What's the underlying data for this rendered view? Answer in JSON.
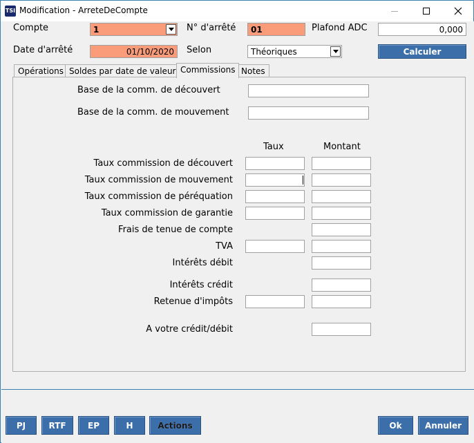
{
  "window": {
    "title": "Modification - ArreteDeCompte",
    "app_icon_text": "TSI"
  },
  "header": {
    "compte_label": "Compte",
    "compte_value": "1",
    "num_arrete_label": "N° d'arrêté",
    "num_arrete_value": "01",
    "plafond_label": "Plafond ADC",
    "plafond_value": "0,000",
    "date_arrete_label": "Date d'arrêté",
    "date_arrete_value": "01/10/2020",
    "selon_label": "Selon",
    "selon_value": "Théoriques",
    "calculer_label": "Calculer"
  },
  "tabs": [
    {
      "label": "Opérations",
      "active": false
    },
    {
      "label": "Soldes par date de valeur",
      "active": false
    },
    {
      "label": "Commissions",
      "active": true
    },
    {
      "label": "Notes",
      "active": false
    }
  ],
  "commissions": {
    "base_decouvert_label": "Base de la comm. de découvert",
    "base_decouvert_value": "",
    "base_mouvement_label": "Base de la comm. de mouvement",
    "base_mouvement_value": "",
    "col_taux": "Taux",
    "col_montant": "Montant",
    "rows": [
      {
        "label": "Taux commission de découvert",
        "taux": "",
        "montant": ""
      },
      {
        "label": "Taux commission de mouvement",
        "taux": "",
        "montant": ""
      },
      {
        "label": "Taux commission de péréquation",
        "taux": "",
        "montant": ""
      },
      {
        "label": "Taux commission de garantie",
        "taux": "",
        "montant": ""
      },
      {
        "label": "Frais de tenue de compte",
        "montant": ""
      },
      {
        "label": "TVA",
        "taux": "",
        "montant": ""
      },
      {
        "label": "Intérêts débit",
        "montant": ""
      },
      {
        "label": "Intérêts crédit",
        "montant": ""
      },
      {
        "label": "Retenue d'impôts",
        "taux": "",
        "montant": ""
      },
      {
        "label": "A votre crédit/débit",
        "montant": ""
      }
    ]
  },
  "footer": {
    "pj_label": "PJ",
    "rtf_label": "RTF",
    "ep_label": "EP",
    "h_label": "H",
    "actions_label": "Actions",
    "ok_label": "Ok",
    "annuler_label": "Annuler"
  },
  "colors": {
    "accent_orange": "#fa9c7a",
    "button_blue": "#3c6eaa",
    "window_border": "#3c7fb1"
  }
}
